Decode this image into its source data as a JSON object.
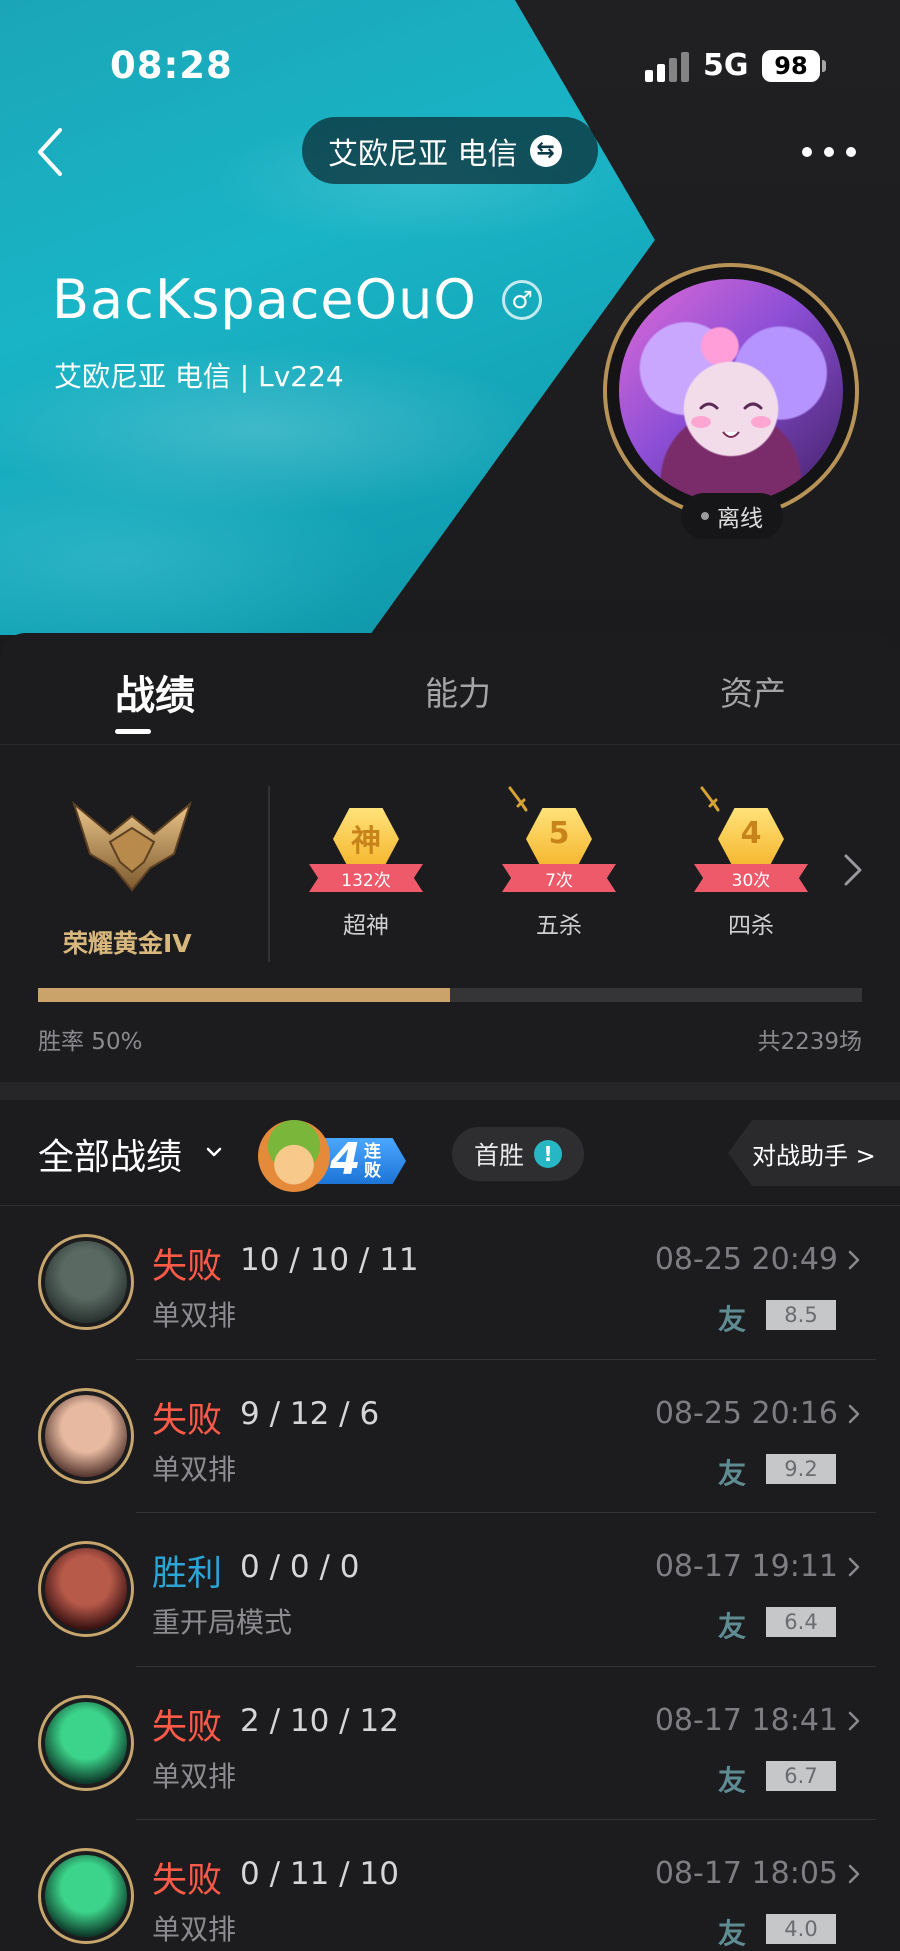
{
  "status_bar": {
    "time": "08:28",
    "network": "5G",
    "battery": "98"
  },
  "header": {
    "server_pill": "艾欧尼亚 电信",
    "player_name": "BacKspaceOuO",
    "gender_symbol": "♂",
    "subtitle": "艾欧尼亚 电信 | Lv224",
    "online_status": "离线",
    "icons": [
      "back-arrow-icon",
      "swap-icon",
      "more-icon",
      "male-icon"
    ]
  },
  "tabs": [
    {
      "label": "战绩",
      "active": true
    },
    {
      "label": "能力",
      "active": false
    },
    {
      "label": "资产",
      "active": false
    }
  ],
  "rank": {
    "name": "荣耀黄金IV",
    "badges": [
      {
        "char": "神",
        "count": "132次",
        "label": "超神"
      },
      {
        "char": "5",
        "count": "7次",
        "label": "五杀"
      },
      {
        "char": "4",
        "count": "30次",
        "label": "四杀"
      }
    ],
    "win_rate_text": "胜率 50%",
    "win_rate_value": 0.5,
    "total_text": "共2239场"
  },
  "filter_bar": {
    "title": "全部战绩",
    "streak_number": "4",
    "streak_text": "连败",
    "first_win": "首胜",
    "first_win_icon": "!",
    "assistant": "对战助手 >"
  },
  "matches": [
    {
      "result": "失败",
      "outcome": "lose",
      "kda": "10 / 10 / 11",
      "mode": "单双排",
      "date": "08-25 20:49",
      "friend": "友",
      "score": "8.5",
      "champion_colors": [
        "#5a6a63",
        "#2a3330"
      ]
    },
    {
      "result": "失败",
      "outcome": "lose",
      "kda": "9 / 12 / 6",
      "mode": "单双排",
      "date": "08-25 20:16",
      "friend": "友",
      "score": "9.2",
      "champion_colors": [
        "#e6b9a0",
        "#5a3a33"
      ]
    },
    {
      "result": "胜利",
      "outcome": "win",
      "kda": "0 / 0 / 0",
      "mode": "重开局模式",
      "date": "08-17 19:11",
      "friend": "友",
      "score": "6.4",
      "champion_colors": [
        "#b85a4a",
        "#3a1212"
      ]
    },
    {
      "result": "失败",
      "outcome": "lose",
      "kda": "2 / 10 / 12",
      "mode": "单双排",
      "date": "08-17 18:41",
      "friend": "友",
      "score": "6.7",
      "champion_colors": [
        "#3cd48a",
        "#0e3a2a"
      ]
    },
    {
      "result": "失败",
      "outcome": "lose",
      "kda": "0 / 11 / 10",
      "mode": "单双排",
      "date": "08-17 18:05",
      "friend": "友",
      "score": "4.0",
      "champion_colors": [
        "#3cd48a",
        "#0e3a2a"
      ]
    }
  ],
  "colors": {
    "accent_gold": "#c9a36a",
    "lose": "#ff5a48",
    "win": "#2ba4d6",
    "hero_teal": "#19b4c6"
  }
}
